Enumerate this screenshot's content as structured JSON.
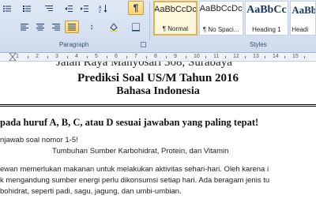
{
  "ribbon": {
    "groups": {
      "paragraph_label": "Paragraph",
      "styles_label": "Styles"
    },
    "styles": [
      {
        "sample": "AaBbCcDc",
        "name": "¶ Normal",
        "selected": true
      },
      {
        "sample": "AaBbCcDc",
        "name": "¶ No Spaci...",
        "selected": false
      },
      {
        "sample": "AaBbCc",
        "name": "Heading 1",
        "selected": false
      },
      {
        "sample": "AaBbCc",
        "name": "Headi",
        "selected": false
      }
    ],
    "buttons": {
      "pilcrow": "¶",
      "line_spacing": "↕"
    },
    "accent_color": "#ffd36b"
  },
  "ruler": {
    "numbers": [
      "1",
      "2",
      "3",
      "4",
      "5",
      "6",
      "7",
      "8",
      "9",
      "10",
      "11",
      "12",
      "13",
      "14",
      "15"
    ]
  },
  "document": {
    "header_cut": "Jalan Raya Manyosari 308, Surabaya",
    "title_line1": "Prediksi Soal US/M Tahun 2016",
    "title_line2": "Bahasa Indonesia",
    "instruction": "pada huruf A, B, C, atau D sesuai jawaban yang paling tepat!",
    "question_intro": "njawab soal nomor 1-5!",
    "passage_title": "Tumbuhan Sumber Karbohidrat, Protein, dan Vitamin",
    "passage_lines": [
      "ewan memerlukan makanan untuk melakukan aktivitas sehari-hari. Oleh karena i",
      "k mengandung sumber energi perlu dikonsumsi setiap hari. Ada beragam jenis tu",
      "bohidrat, seperti padi, sagu, jagung, dan umbi-umbian."
    ]
  }
}
